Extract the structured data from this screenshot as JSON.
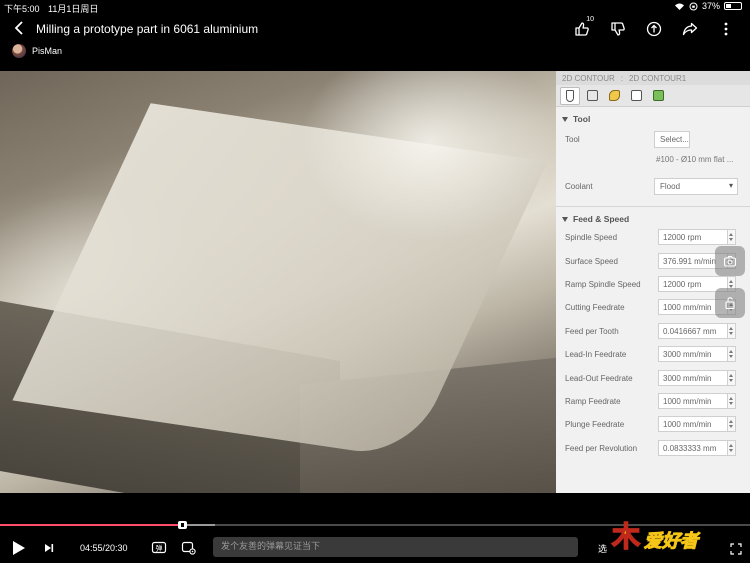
{
  "status_bar": {
    "time": "下午5:00",
    "date": "11月1日周日",
    "battery": "37%"
  },
  "header": {
    "title": "Milling a prototype part in 6061 aluminium",
    "like_count": "10",
    "author": "PisMan",
    "icons": [
      "back-chevron",
      "thumbs-up",
      "thumbs-down",
      "coin",
      "share",
      "more-vertical"
    ]
  },
  "cam_panel": {
    "breadcrumb": [
      "2D CONTOUR",
      ":",
      "2D CONTOUR1"
    ],
    "tool_section": {
      "heading": "Tool",
      "tool_label": "Tool",
      "tool_button": "Select...",
      "tool_name": "#100 - Ø10 mm flat ...",
      "coolant_label": "Coolant",
      "coolant_value": "Flood"
    },
    "feed_section": {
      "heading": "Feed & Speed",
      "rows": [
        {
          "label": "Spindle Speed",
          "value": "12000 rpm"
        },
        {
          "label": "Surface Speed",
          "value": "376.991 m/min"
        },
        {
          "label": "Ramp Spindle Speed",
          "value": "12000 rpm"
        },
        {
          "label": "Cutting Feedrate",
          "value": "1000 mm/min"
        },
        {
          "label": "Feed per Tooth",
          "value": "0.0416667 mm"
        },
        {
          "label": "Lead-In Feedrate",
          "value": "3000 mm/min"
        },
        {
          "label": "Lead-Out Feedrate",
          "value": "3000 mm/min"
        },
        {
          "label": "Ramp Feedrate",
          "value": "1000 mm/min"
        },
        {
          "label": "Plunge Feedrate",
          "value": "1000 mm/min"
        },
        {
          "label": "Feed per Revolution",
          "value": "0.0833333 mm"
        }
      ]
    }
  },
  "player": {
    "time": "04:55/20:30",
    "progress_fraction": 0.243,
    "buffered_fraction": 0.287,
    "danmu_placeholder": "发个友善的弹幕见证当下",
    "danmu_toggle_label": "弹",
    "select_label": "选",
    "watermark": "爱好者",
    "watermark_lead": "木"
  },
  "colors": {
    "progress_played": "#ff4d6a",
    "panel_bg": "#f1f1f1"
  }
}
